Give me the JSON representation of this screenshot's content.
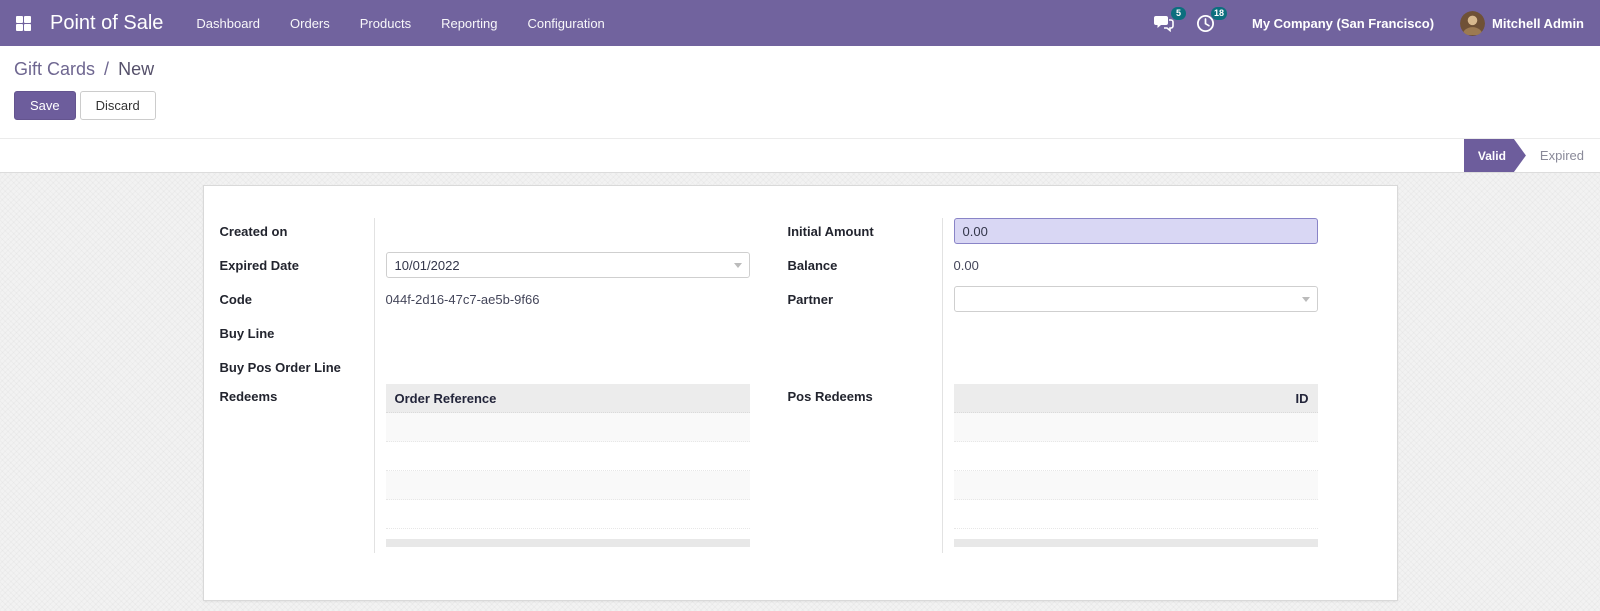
{
  "navbar": {
    "app_name": "Point of Sale",
    "menu_items": [
      "Dashboard",
      "Orders",
      "Products",
      "Reporting",
      "Configuration"
    ],
    "messages_count": "5",
    "activities_count": "18",
    "company_name": "My Company (San Francisco)",
    "user_name": "Mitchell Admin"
  },
  "breadcrumb": {
    "parent": "Gift Cards",
    "separator": "/",
    "current": "New"
  },
  "control_panel": {
    "save_label": "Save",
    "discard_label": "Discard"
  },
  "statusbar": {
    "states": [
      {
        "label": "Valid",
        "active": true
      },
      {
        "label": "Expired",
        "active": false
      }
    ]
  },
  "form": {
    "fields": {
      "created_on": {
        "label": "Created on",
        "value": ""
      },
      "expired_date": {
        "label": "Expired Date",
        "value": "10/01/2022"
      },
      "code": {
        "label": "Code",
        "value": "044f-2d16-47c7-ae5b-9f66"
      },
      "buy_line": {
        "label": "Buy Line",
        "value": ""
      },
      "buy_pos_order_line": {
        "label": "Buy Pos Order Line",
        "value": ""
      },
      "redeems": {
        "label": "Redeems"
      },
      "initial_amount": {
        "label": "Initial Amount",
        "value": "0.00"
      },
      "balance": {
        "label": "Balance",
        "value": "0.00"
      },
      "partner": {
        "label": "Partner",
        "value": ""
      },
      "pos_redeems": {
        "label": "Pos Redeems"
      }
    },
    "tables": {
      "redeems": {
        "columns": [
          "Order Reference"
        ],
        "rows": [],
        "visible_empty_rows": 4
      },
      "pos_redeems": {
        "columns": [
          "ID"
        ],
        "rows": [],
        "visible_empty_rows": 4
      }
    }
  },
  "colors": {
    "navbar": "#71639e",
    "accent": "#6d5d9c",
    "badge": "#0c6f7e",
    "highlight_bg": "#d9d7f4",
    "highlight_border": "#8984c7"
  }
}
